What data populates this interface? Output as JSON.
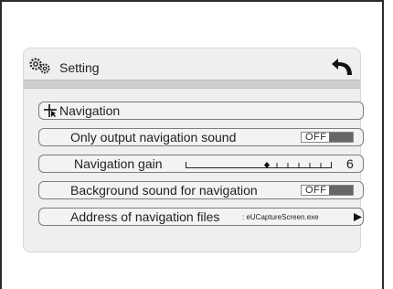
{
  "window": {
    "title": "Setting"
  },
  "header": {
    "back_icon": "back-arrow-icon",
    "settings_icon": "gear-icon"
  },
  "rows": [
    {
      "label": "Navigation",
      "icon": "navigation-crosshair-icon"
    },
    {
      "label": "Only output navigation sound",
      "toggle": "OFF"
    },
    {
      "label": "Navigation gain",
      "value": "6",
      "level_fraction": 0.56
    },
    {
      "label": "Background sound for navigation",
      "toggle": "OFF"
    },
    {
      "label": "Address of navigation files",
      "value": ": eUCaptureScreen.exe",
      "icon": "right-arrow-icon"
    }
  ],
  "colors": {
    "panel": "#efefef",
    "row_border": "#7d7d7d",
    "toggle_knob": "#666666"
  }
}
